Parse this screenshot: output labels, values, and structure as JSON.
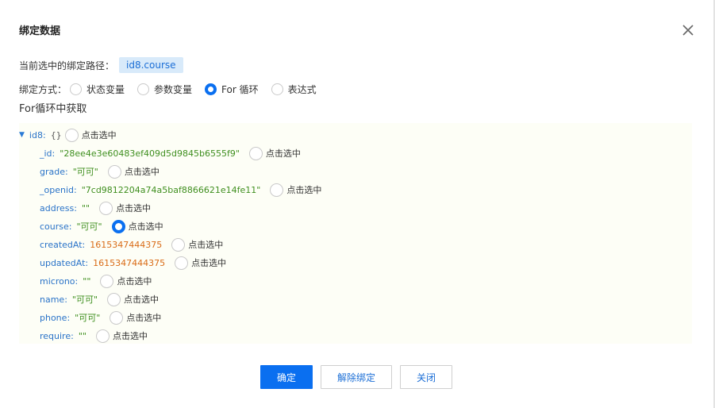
{
  "dialog": {
    "title": "绑定数据"
  },
  "path": {
    "label": "当前选中的绑定路径：",
    "value": "id8.course"
  },
  "mode": {
    "label": "绑定方式：",
    "options": [
      {
        "label": "状态变量",
        "selected": false
      },
      {
        "label": "参数变量",
        "selected": false
      },
      {
        "label": "For 循环",
        "selected": true
      },
      {
        "label": "表达式",
        "selected": false
      }
    ]
  },
  "section_label": "For循环中获取",
  "pick_label": "点击选中",
  "tree": {
    "root": {
      "key": "id8",
      "value": "{}"
    },
    "items": [
      {
        "key": "_id",
        "value": "\"28ee4e3e60483ef409d5d9845b6555f9\"",
        "kind": "string",
        "selected": false
      },
      {
        "key": "grade",
        "value": "\"可可\"",
        "kind": "string",
        "selected": false
      },
      {
        "key": "_openid",
        "value": "\"7cd9812204a74a5baf8866621e14fe11\"",
        "kind": "string",
        "selected": false
      },
      {
        "key": "address",
        "value": "\"\"",
        "kind": "string",
        "selected": false
      },
      {
        "key": "course",
        "value": "\"可可\"",
        "kind": "string",
        "selected": true
      },
      {
        "key": "createdAt",
        "value": "1615347444375",
        "kind": "number",
        "selected": false
      },
      {
        "key": "updatedAt",
        "value": "1615347444375",
        "kind": "number",
        "selected": false
      },
      {
        "key": "microno",
        "value": "\"\"",
        "kind": "string",
        "selected": false
      },
      {
        "key": "name",
        "value": "\"可可\"",
        "kind": "string",
        "selected": false
      },
      {
        "key": "phone",
        "value": "\"可可\"",
        "kind": "string",
        "selected": false
      },
      {
        "key": "require",
        "value": "\"\"",
        "kind": "string",
        "selected": false
      }
    ]
  },
  "buttons": {
    "confirm": "确定",
    "unbind": "解除绑定",
    "close": "关闭"
  },
  "colors": {
    "primary": "#0a6ff0",
    "key": "#2a73c8",
    "string_value": "#3f8f1f",
    "number_value": "#d96b16",
    "tree_background": "#fdfef6",
    "path_tag_background": "#d8eafa"
  }
}
